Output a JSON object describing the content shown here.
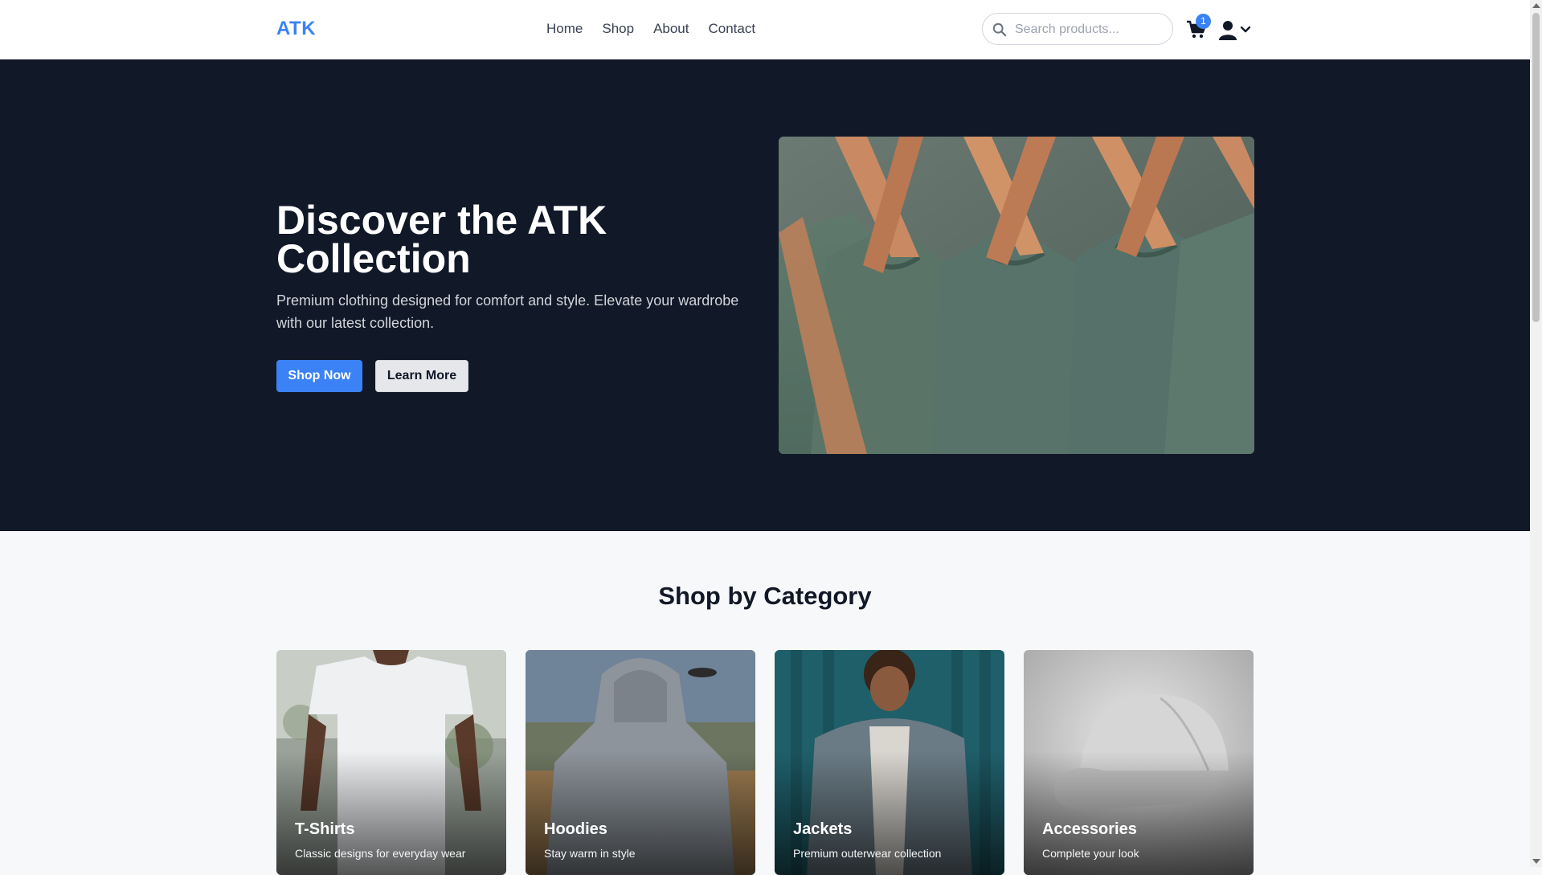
{
  "header": {
    "logo": "ATK",
    "nav": [
      "Home",
      "Shop",
      "About",
      "Contact"
    ],
    "search_placeholder": "Search products...",
    "cart_count": "1",
    "icons": [
      "search-icon",
      "cart-icon",
      "user-icon",
      "chevron-down-icon"
    ]
  },
  "hero": {
    "title": "Discover the ATK Collection",
    "subtitle": "Premium clothing designed for comfort and style. Elevate your wardrobe with our latest collection.",
    "primary_button": "Shop Now",
    "secondary_button": "Learn More"
  },
  "categories": {
    "title": "Shop by Category",
    "items": [
      {
        "name": "T-Shirts",
        "description": "Classic designs for everyday wear"
      },
      {
        "name": "Hoodies",
        "description": "Stay warm in style"
      },
      {
        "name": "Jackets",
        "description": "Premium outerwear collection"
      },
      {
        "name": "Accessories",
        "description": "Complete your look"
      }
    ]
  },
  "colors": {
    "accent": "#3b82f6",
    "hero_bg": "#111827",
    "page_bg": "#f7f8fa"
  }
}
